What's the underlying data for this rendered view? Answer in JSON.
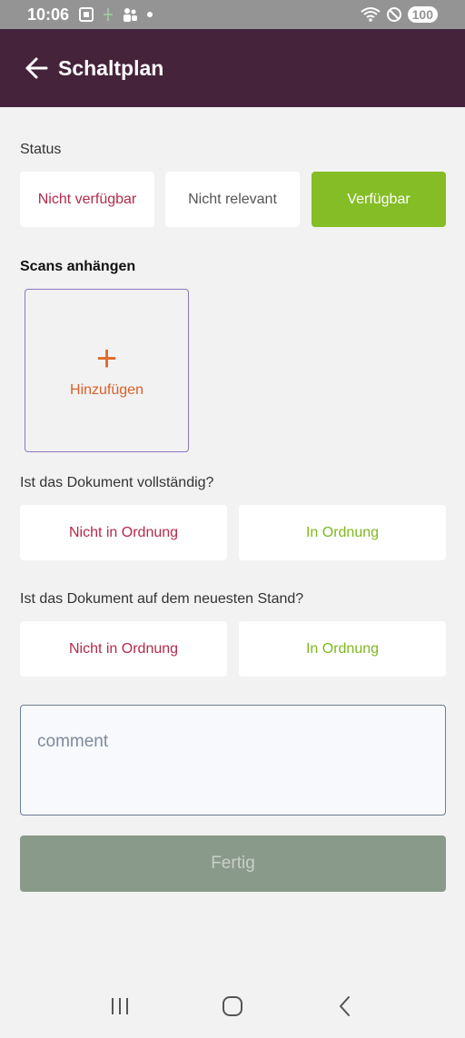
{
  "status_bar": {
    "time": "10:06",
    "battery": "100"
  },
  "app_bar": {
    "title": "Schaltplan"
  },
  "status_section": {
    "label": "Status",
    "options": [
      "Nicht verfügbar",
      "Nicht relevant",
      "Verfügbar"
    ],
    "selected": "Verfügbar"
  },
  "scans_section": {
    "label": "Scans anhängen",
    "add_label": "Hinzufügen"
  },
  "complete_question": {
    "label": "Ist das Dokument vollständig?",
    "not_ok": "Nicht in Ordnung",
    "ok": "In Ordnung"
  },
  "uptodate_question": {
    "label": "Ist das Dokument auf dem neuesten Stand?",
    "not_ok": "Nicht in Ordnung",
    "ok": "In Ordnung"
  },
  "comment": {
    "placeholder": "comment",
    "value": ""
  },
  "done_button": {
    "label": "Fertig"
  },
  "colors": {
    "app_bar": "#45233b",
    "selected": "#84bd25",
    "negative": "#b32a4c",
    "positive": "#7fb820",
    "add_accent": "#e06a2b",
    "done_disabled": "#8a9a8a"
  }
}
